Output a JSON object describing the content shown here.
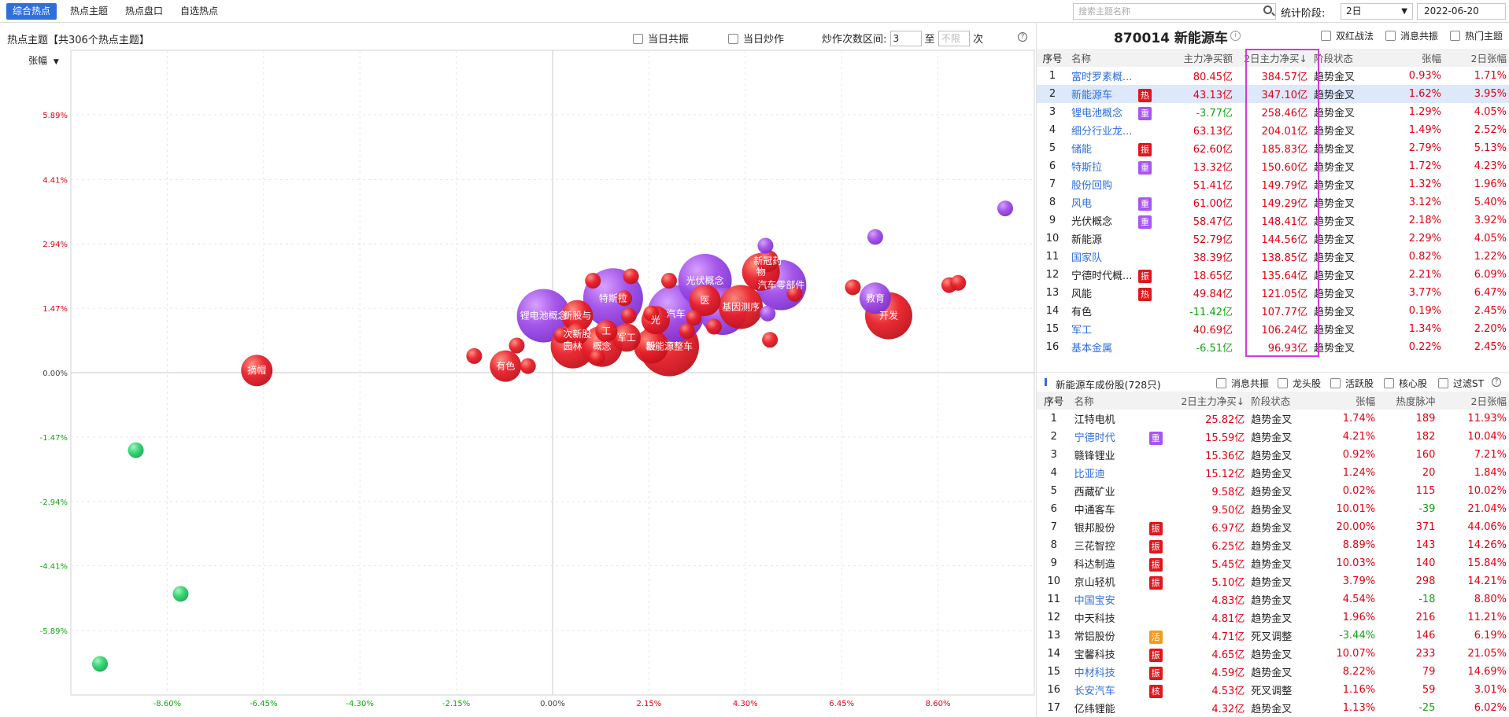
{
  "nav": {
    "tabs": [
      "综合热点",
      "热点主题",
      "热点盘口",
      "自选热点"
    ],
    "search_placeholder": "搜索主题名称",
    "stat_label": "统计阶段:",
    "period": "2日",
    "date": "2022-06-20"
  },
  "chart_header": {
    "title": "热点主题【共306个热点主题】",
    "resonance_label": "当日共振",
    "hype_label": "当日炒作",
    "range_label": "炒作次数区间:",
    "range_from": "3",
    "to_label": "至",
    "range_to_placeholder": "不限",
    "times_label": "次",
    "help": "?",
    "sort_label": "张幅"
  },
  "chart_data": {
    "type": "scatter",
    "ylabel": "张幅",
    "x_ticks": [
      "-8.60%",
      "-6.45%",
      "-4.30%",
      "-2.15%",
      "0.00%",
      "2.15%",
      "4.30%",
      "6.45%",
      "8.60%"
    ],
    "y_ticks": [
      "5.89%",
      "4.41%",
      "2.94%",
      "1.47%",
      "0.00%",
      "-1.47%",
      "-2.94%",
      "-4.41%",
      "-5.89%"
    ],
    "xlim": [
      -10.75,
      10.75
    ],
    "ylim": [
      -7.36,
      7.36
    ],
    "points": [
      {
        "x": -6.6,
        "y": 0.05,
        "r": 20,
        "c": "red",
        "label": "摘帽"
      },
      {
        "x": -9.3,
        "y": -1.77,
        "r": 10,
        "c": "green",
        "label": ""
      },
      {
        "x": -8.3,
        "y": -5.05,
        "r": 10,
        "c": "green",
        "label": ""
      },
      {
        "x": -10.1,
        "y": -6.65,
        "r": 10,
        "c": "green",
        "label": ""
      },
      {
        "x": -1.75,
        "y": 0.38,
        "r": 10,
        "c": "red",
        "label": ""
      },
      {
        "x": -1.05,
        "y": 0.15,
        "r": 20,
        "c": "red",
        "label": "有色"
      },
      {
        "x": -0.8,
        "y": 0.62,
        "r": 10,
        "c": "red",
        "label": ""
      },
      {
        "x": -0.55,
        "y": 0.15,
        "r": 10,
        "c": "red",
        "label": ""
      },
      {
        "x": -0.2,
        "y": 1.3,
        "r": 34,
        "c": "purple",
        "label": "锂电池概念"
      },
      {
        "x": 0.55,
        "y": 1.3,
        "r": 20,
        "c": "red",
        "label": "新股与"
      },
      {
        "x": 0.55,
        "y": 0.88,
        "r": 14,
        "c": "red",
        "label": "次新股"
      },
      {
        "x": 0.45,
        "y": 0.6,
        "r": 28,
        "c": "red",
        "label": "园林"
      },
      {
        "x": 1.1,
        "y": 0.6,
        "r": 26,
        "c": "red",
        "label": "概念"
      },
      {
        "x": 1.2,
        "y": 0.95,
        "r": 14,
        "c": "red",
        "label": "工"
      },
      {
        "x": 1.35,
        "y": 1.7,
        "r": 38,
        "c": "purple",
        "label": "特斯拉"
      },
      {
        "x": 0.9,
        "y": 2.1,
        "r": 10,
        "c": "red",
        "label": ""
      },
      {
        "x": 1.75,
        "y": 2.2,
        "r": 10,
        "c": "red",
        "label": ""
      },
      {
        "x": 1.65,
        "y": 0.8,
        "r": 18,
        "c": "red",
        "label": "军工"
      },
      {
        "x": 2.2,
        "y": 0.6,
        "r": 22,
        "c": "red",
        "label": "股"
      },
      {
        "x": 2.6,
        "y": 0.6,
        "r": 38,
        "c": "red",
        "label": "新能源整车"
      },
      {
        "x": 2.3,
        "y": 1.2,
        "r": 18,
        "c": "red",
        "label": "光"
      },
      {
        "x": 2.75,
        "y": 1.35,
        "r": 36,
        "c": "purple",
        "label": "汽车"
      },
      {
        "x": 3.4,
        "y": 2.1,
        "r": 34,
        "c": "purple",
        "label": "光伏概念"
      },
      {
        "x": 3.4,
        "y": 1.65,
        "r": 20,
        "c": "red",
        "label": "医"
      },
      {
        "x": 3.8,
        "y": 1.4,
        "r": 30,
        "c": "purple",
        "label": ""
      },
      {
        "x": 4.2,
        "y": 1.5,
        "r": 28,
        "c": "red",
        "label": "基因测序"
      },
      {
        "x": 4.65,
        "y": 2.3,
        "r": 24,
        "c": "red",
        "label": "物"
      },
      {
        "x": 4.8,
        "y": 2.55,
        "r": 14,
        "c": "red",
        "label": "新冠药"
      },
      {
        "x": 5.1,
        "y": 2.0,
        "r": 32,
        "c": "purple",
        "label": "汽车零部件"
      },
      {
        "x": 4.8,
        "y": 1.35,
        "r": 10,
        "c": "purple",
        "label": ""
      },
      {
        "x": 4.75,
        "y": 2.9,
        "r": 10,
        "c": "purple",
        "label": ""
      },
      {
        "x": 4.85,
        "y": 0.75,
        "r": 10,
        "c": "red",
        "label": ""
      },
      {
        "x": 5.4,
        "y": 1.8,
        "r": 10,
        "c": "red",
        "label": ""
      },
      {
        "x": 2.6,
        "y": 2.1,
        "r": 10,
        "c": "red",
        "label": ""
      },
      {
        "x": 3.15,
        "y": 1.25,
        "r": 10,
        "c": "red",
        "label": ""
      },
      {
        "x": 3.6,
        "y": 1.05,
        "r": 10,
        "c": "red",
        "label": ""
      },
      {
        "x": 2.2,
        "y": 1.35,
        "r": 10,
        "c": "red",
        "label": ""
      },
      {
        "x": 3.0,
        "y": 0.95,
        "r": 10,
        "c": "red",
        "label": ""
      },
      {
        "x": 1.7,
        "y": 1.3,
        "r": 10,
        "c": "red",
        "label": ""
      },
      {
        "x": 1.6,
        "y": 1.7,
        "r": 10,
        "c": "red",
        "label": ""
      },
      {
        "x": 6.7,
        "y": 1.95,
        "r": 10,
        "c": "red",
        "label": ""
      },
      {
        "x": 7.5,
        "y": 1.3,
        "r": 30,
        "c": "red",
        "label": "开发"
      },
      {
        "x": 7.2,
        "y": 1.7,
        "r": 20,
        "c": "purple",
        "label": "教育"
      },
      {
        "x": 7.2,
        "y": 3.1,
        "r": 10,
        "c": "purple",
        "label": ""
      },
      {
        "x": 8.85,
        "y": 2.0,
        "r": 10,
        "c": "red",
        "label": ""
      },
      {
        "x": 9.05,
        "y": 2.05,
        "r": 10,
        "c": "red",
        "label": ""
      },
      {
        "x": 10.1,
        "y": 3.75,
        "r": 10,
        "c": "purple",
        "label": ""
      },
      {
        "x": 0.2,
        "y": 0.85,
        "r": 10,
        "c": "red",
        "label": ""
      },
      {
        "x": 1.0,
        "y": 0.35,
        "r": 10,
        "c": "red",
        "label": ""
      }
    ]
  },
  "right_header": {
    "title": "870014 新能源车",
    "info": "i",
    "checks": [
      "双红战法",
      "消息共振",
      "热门主题"
    ]
  },
  "topic_table": {
    "headers": [
      "序号",
      "名称",
      "主力净买额",
      "2日主力净买↓",
      "阶段状态",
      "张幅",
      "2日张幅"
    ],
    "rows": [
      {
        "no": "1",
        "name": "富时罗素概...",
        "link": true,
        "tag": "",
        "net": "80.45亿",
        "net2": "384.57亿",
        "state": "趋势金叉",
        "chg": "0.93%",
        "chg2": "1.71%"
      },
      {
        "no": "2",
        "name": "新能源车",
        "link": true,
        "tag": "热",
        "net": "43.13亿",
        "net2": "347.10亿",
        "state": "趋势金叉",
        "chg": "1.62%",
        "chg2": "3.95%",
        "sel": true
      },
      {
        "no": "3",
        "name": "锂电池概念",
        "link": true,
        "tag": "重",
        "net": "-3.77亿",
        "net2": "258.46亿",
        "state": "趋势金叉",
        "chg": "1.29%",
        "chg2": "4.05%"
      },
      {
        "no": "4",
        "name": "细分行业龙...",
        "link": true,
        "tag": "",
        "net": "63.13亿",
        "net2": "204.01亿",
        "state": "趋势金叉",
        "chg": "1.49%",
        "chg2": "2.52%"
      },
      {
        "no": "5",
        "name": "储能",
        "link": true,
        "tag": "振",
        "net": "62.60亿",
        "net2": "185.83亿",
        "state": "趋势金叉",
        "chg": "2.79%",
        "chg2": "5.13%"
      },
      {
        "no": "6",
        "name": "特斯拉",
        "link": true,
        "tag": "重",
        "net": "13.32亿",
        "net2": "150.60亿",
        "state": "趋势金叉",
        "chg": "1.72%",
        "chg2": "4.23%"
      },
      {
        "no": "7",
        "name": "股份回购",
        "link": true,
        "tag": "",
        "net": "51.41亿",
        "net2": "149.79亿",
        "state": "趋势金叉",
        "chg": "1.32%",
        "chg2": "1.96%"
      },
      {
        "no": "8",
        "name": "风电",
        "link": true,
        "tag": "重",
        "net": "61.00亿",
        "net2": "149.29亿",
        "state": "趋势金叉",
        "chg": "3.12%",
        "chg2": "5.40%"
      },
      {
        "no": "9",
        "name": "光伏概念",
        "link": false,
        "tag": "重",
        "net": "58.47亿",
        "net2": "148.41亿",
        "state": "趋势金叉",
        "chg": "2.18%",
        "chg2": "3.92%"
      },
      {
        "no": "10",
        "name": "新能源",
        "link": false,
        "tag": "",
        "net": "52.79亿",
        "net2": "144.56亿",
        "state": "趋势金叉",
        "chg": "2.29%",
        "chg2": "4.05%"
      },
      {
        "no": "11",
        "name": "国家队",
        "link": true,
        "tag": "",
        "net": "38.39亿",
        "net2": "138.85亿",
        "state": "趋势金叉",
        "chg": "0.82%",
        "chg2": "1.22%"
      },
      {
        "no": "12",
        "name": "宁德时代概...",
        "link": false,
        "tag": "振",
        "net": "18.65亿",
        "net2": "135.64亿",
        "state": "趋势金叉",
        "chg": "2.21%",
        "chg2": "6.09%"
      },
      {
        "no": "13",
        "name": "风能",
        "link": false,
        "tag": "热",
        "net": "49.84亿",
        "net2": "121.05亿",
        "state": "趋势金叉",
        "chg": "3.77%",
        "chg2": "6.47%"
      },
      {
        "no": "14",
        "name": "有色",
        "link": false,
        "tag": "",
        "net": "-11.42亿",
        "net2": "107.77亿",
        "state": "趋势金叉",
        "chg": "0.19%",
        "chg2": "2.45%"
      },
      {
        "no": "15",
        "name": "军工",
        "link": true,
        "tag": "",
        "net": "40.69亿",
        "net2": "106.24亿",
        "state": "趋势金叉",
        "chg": "1.34%",
        "chg2": "2.20%"
      },
      {
        "no": "16",
        "name": "基本金属",
        "link": true,
        "tag": "",
        "net": "-6.51亿",
        "net2": "96.93亿",
        "state": "趋势金叉",
        "chg": "0.22%",
        "chg2": "2.45%"
      }
    ]
  },
  "sub_header": {
    "title": "新能源车成份股(728只)",
    "checks": [
      "消息共振",
      "龙头股",
      "活跃股",
      "核心股",
      "过滤ST"
    ],
    "help": "?"
  },
  "stock_table": {
    "headers": [
      "序号",
      "名称",
      "2日主力净买↓",
      "阶段状态",
      "张幅",
      "热度脉冲",
      "2日张幅"
    ],
    "rows": [
      {
        "no": "1",
        "name": "江特电机",
        "link": false,
        "tag": "",
        "net2": "25.82亿",
        "state": "趋势金叉",
        "chg": "1.74%",
        "heat": "189",
        "chg2": "11.93%"
      },
      {
        "no": "2",
        "name": "宁德时代",
        "link": true,
        "tag": "重",
        "net2": "15.59亿",
        "state": "趋势金叉",
        "chg": "4.21%",
        "heat": "182",
        "chg2": "10.04%"
      },
      {
        "no": "3",
        "name": "赣锋锂业",
        "link": false,
        "tag": "",
        "net2": "15.36亿",
        "state": "趋势金叉",
        "chg": "0.92%",
        "heat": "160",
        "chg2": "7.21%"
      },
      {
        "no": "4",
        "name": "比亚迪",
        "link": true,
        "tag": "",
        "net2": "15.12亿",
        "state": "趋势金叉",
        "chg": "1.24%",
        "heat": "20",
        "chg2": "1.84%"
      },
      {
        "no": "5",
        "name": "西藏矿业",
        "link": false,
        "tag": "",
        "net2": "9.58亿",
        "state": "趋势金叉",
        "chg": "0.02%",
        "heat": "115",
        "chg2": "10.02%"
      },
      {
        "no": "6",
        "name": "中通客车",
        "link": false,
        "tag": "",
        "net2": "9.50亿",
        "state": "趋势金叉",
        "chg": "10.01%",
        "heat": "-39",
        "chg2": "21.04%"
      },
      {
        "no": "7",
        "name": "银邦股份",
        "link": false,
        "tag": "振",
        "net2": "6.97亿",
        "state": "趋势金叉",
        "chg": "20.00%",
        "heat": "371",
        "chg2": "44.06%"
      },
      {
        "no": "8",
        "name": "三花智控",
        "link": false,
        "tag": "振",
        "net2": "6.25亿",
        "state": "趋势金叉",
        "chg": "8.89%",
        "heat": "143",
        "chg2": "14.26%"
      },
      {
        "no": "9",
        "name": "科达制造",
        "link": false,
        "tag": "振",
        "net2": "5.45亿",
        "state": "趋势金叉",
        "chg": "10.03%",
        "heat": "140",
        "chg2": "15.84%"
      },
      {
        "no": "10",
        "name": "京山轻机",
        "link": false,
        "tag": "振",
        "net2": "5.10亿",
        "state": "趋势金叉",
        "chg": "3.79%",
        "heat": "298",
        "chg2": "14.21%"
      },
      {
        "no": "11",
        "name": "中国宝安",
        "link": true,
        "tag": "",
        "net2": "4.83亿",
        "state": "趋势金叉",
        "chg": "4.54%",
        "heat": "-18",
        "chg2": "8.80%"
      },
      {
        "no": "12",
        "name": "中天科技",
        "link": false,
        "tag": "",
        "net2": "4.81亿",
        "state": "趋势金叉",
        "chg": "1.96%",
        "heat": "216",
        "chg2": "11.21%"
      },
      {
        "no": "13",
        "name": "常铝股份",
        "link": false,
        "tag": "活",
        "net2": "4.71亿",
        "state": "死叉调整",
        "chg": "-3.44%",
        "heat": "146",
        "chg2": "6.19%"
      },
      {
        "no": "14",
        "name": "宝馨科技",
        "link": false,
        "tag": "振",
        "net2": "4.65亿",
        "state": "趋势金叉",
        "chg": "10.07%",
        "heat": "233",
        "chg2": "21.05%"
      },
      {
        "no": "15",
        "name": "中材科技",
        "link": true,
        "tag": "振",
        "net2": "4.59亿",
        "state": "趋势金叉",
        "chg": "8.22%",
        "heat": "79",
        "chg2": "14.69%"
      },
      {
        "no": "16",
        "name": "长安汽车",
        "link": true,
        "tag": "核",
        "net2": "4.53亿",
        "state": "死叉调整",
        "chg": "1.16%",
        "heat": "59",
        "chg2": "3.01%"
      },
      {
        "no": "17",
        "name": "亿纬锂能",
        "link": false,
        "tag": "",
        "net2": "4.32亿",
        "state": "趋势金叉",
        "chg": "1.13%",
        "heat": "-25",
        "chg2": "6.02%"
      }
    ]
  }
}
